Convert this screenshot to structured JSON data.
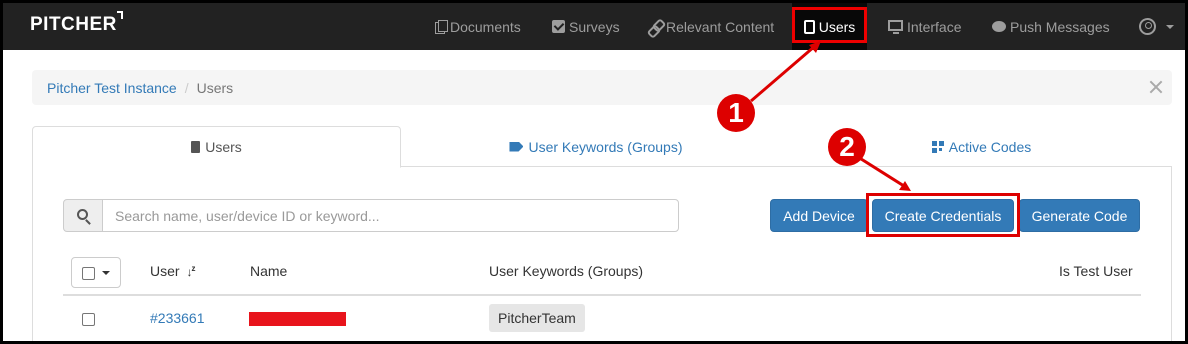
{
  "brand": {
    "name": "PITCHER"
  },
  "nav": {
    "items": [
      {
        "label": "Documents",
        "icon": "documents-icon"
      },
      {
        "label": "Surveys",
        "icon": "check-square-icon"
      },
      {
        "label": "Relevant Content",
        "icon": "link-icon"
      },
      {
        "label": "Users",
        "icon": "tablet-icon",
        "active": true
      },
      {
        "label": "Interface",
        "icon": "monitor-icon"
      },
      {
        "label": "Push Messages",
        "icon": "chat-bubble-icon"
      }
    ],
    "account_icon": "user-circle-icon"
  },
  "breadcrumb": {
    "root": "Pitcher Test Instance",
    "separator": "/",
    "current": "Users"
  },
  "tabs": [
    {
      "label": "Users",
      "active": true
    },
    {
      "label": "User Keywords (Groups)",
      "active": false
    },
    {
      "label": "Active Codes",
      "active": false
    }
  ],
  "search": {
    "placeholder": "Search name, user/device ID or keyword...",
    "value": ""
  },
  "buttons": {
    "add_device": "Add Device",
    "create_credentials": "Create Credentials",
    "generate_code": "Generate Code"
  },
  "table": {
    "headers": {
      "user": "User",
      "name": "Name",
      "keywords": "User Keywords (Groups)",
      "test_user": "Is Test User"
    },
    "sort_indicator": "↓",
    "rows": [
      {
        "user": "#233661",
        "name": "",
        "keyword": "PitcherTeam",
        "test_user": ""
      }
    ]
  },
  "annotations": {
    "step1": "1",
    "step2": "2",
    "highlight_color": "#dd0000"
  },
  "colors": {
    "navbar": "#222222",
    "primary": "#337ab7",
    "link": "#337ab7"
  }
}
